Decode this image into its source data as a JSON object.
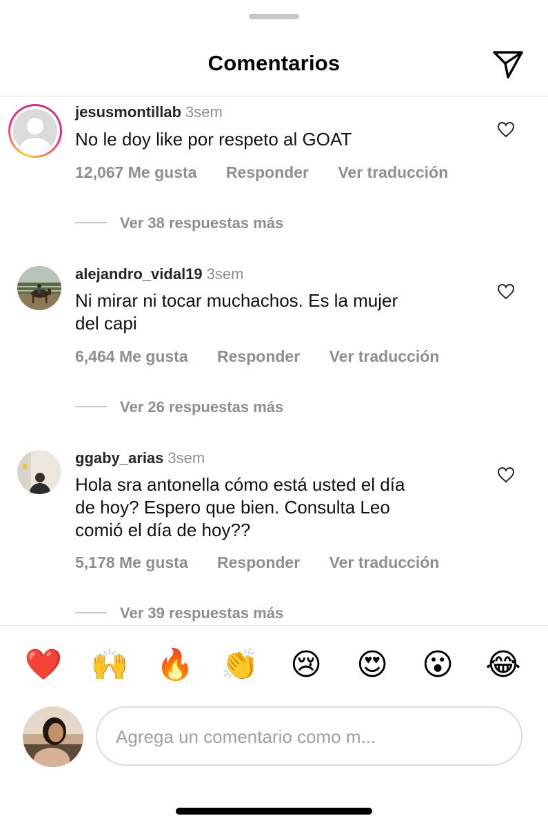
{
  "header": {
    "title": "Comentarios",
    "share_icon": "send-icon"
  },
  "comments": [
    {
      "username": "jesusmontillab",
      "time": "3sem",
      "text": "No le doy like por respeto al GOAT",
      "likes": "12,067 Me gusta",
      "reply_label": "Responder",
      "translate_label": "Ver traducción",
      "replies_label": "Ver 38 respuestas más",
      "avatar": "default-avatar-with-story-ring"
    },
    {
      "username": "alejandro_vidal19",
      "time": "3sem",
      "text_lines": [
        "Ni mirar ni tocar muchachos. Es la mujer",
        "del capi"
      ],
      "likes": "6,464 Me gusta",
      "reply_label": "Responder",
      "translate_label": "Ver traducción",
      "replies_label": "Ver 26 respuestas más",
      "avatar": "photo-horse"
    },
    {
      "username": "ggaby_arias",
      "time": "3sem",
      "text_lines": [
        "Hola sra antonella cómo está usted el día",
        "de hoy? Espero que bien. Consulta Leo",
        "comió el día de hoy??"
      ],
      "likes": "5,178 Me gusta",
      "reply_label": "Responder",
      "translate_label": "Ver traducción",
      "replies_label": "Ver 39 respuestas más",
      "avatar": "photo-person"
    }
  ],
  "emoji_bar": [
    "❤️",
    "🙌",
    "🔥",
    "👏",
    "😢",
    "😍",
    "😮",
    "😂"
  ],
  "composer": {
    "placeholder": "Agrega un comentario como m..."
  },
  "colors": {
    "secondary_text": "#8e8e8e",
    "divider": "#e3e3e3",
    "story_ring": "#ee2a7b"
  }
}
